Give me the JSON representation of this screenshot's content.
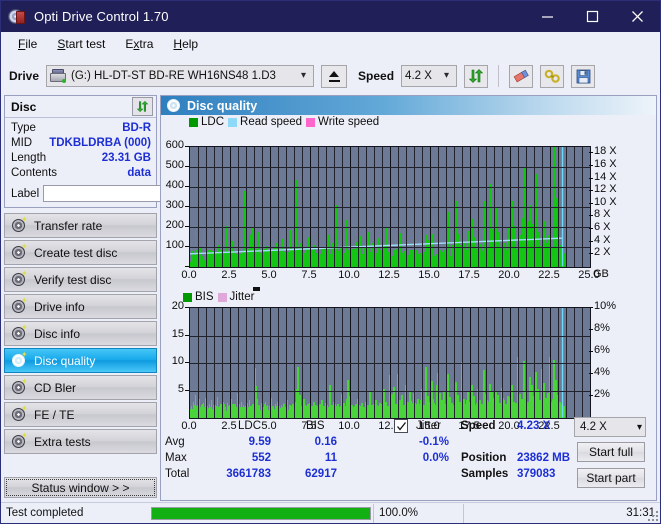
{
  "window": {
    "title": "Opti Drive Control 1.70",
    "app_icon": "disc-icon",
    "minimize": "minimize-icon",
    "maximize": "maximize-icon",
    "close": "close-icon"
  },
  "menu": {
    "items": [
      {
        "label": "File",
        "accel": "F"
      },
      {
        "label": "Start test",
        "accel": "S"
      },
      {
        "label": "Extra",
        "accel": "x"
      },
      {
        "label": "Help",
        "accel": "H"
      }
    ]
  },
  "toolbar": {
    "drive_label": "Drive",
    "drive_value": "(G:)  HL-DT-ST BD-RE  WH16NS48 1.D3",
    "eject_title": "eject-button",
    "speed_label": "Speed",
    "speed_value": "4.2 X",
    "refresh_title": "refresh-button",
    "erase_title": "erase-button",
    "tools_title": "tools-button",
    "save_title": "save-button"
  },
  "disc_panel": {
    "title": "Disc",
    "refresh_title": "refresh-disc-button",
    "rows": [
      {
        "key": "Type",
        "value": "BD-R"
      },
      {
        "key": "MID",
        "value": "TDKBLDRBA (000)"
      },
      {
        "key": "Length",
        "value": "23.31 GB"
      },
      {
        "key": "Contents",
        "value": "data"
      }
    ],
    "label_key": "Label",
    "label_value": "",
    "label_placeholder": ""
  },
  "sidebar": {
    "items": [
      {
        "label": "Transfer rate",
        "active": false
      },
      {
        "label": "Create test disc",
        "active": false
      },
      {
        "label": "Verify test disc",
        "active": false
      },
      {
        "label": "Drive info",
        "active": false
      },
      {
        "label": "Disc info",
        "active": false
      },
      {
        "label": "Disc quality",
        "active": true
      },
      {
        "label": "CD Bler",
        "active": false
      },
      {
        "label": "FE / TE",
        "active": false
      },
      {
        "label": "Extra tests",
        "active": false
      }
    ],
    "status_window_button": "Status window > >"
  },
  "content": {
    "header_title": "Disc quality",
    "header_icon": "disc-quality-icon"
  },
  "chart_data": [
    {
      "type": "bar",
      "id": "ldc-chart",
      "title": "",
      "xlabel": "GB",
      "ylabel": "LDC",
      "ylim": [
        0,
        600
      ],
      "xlim": [
        0,
        25
      ],
      "grid": true,
      "legend_position": "top-left",
      "legend": [
        {
          "name": "LDC",
          "color": "#009900"
        },
        {
          "name": "Read speed",
          "color": "#8ed8f8"
        },
        {
          "name": "Write speed",
          "color": "#ff66cc"
        }
      ],
      "yticks": [
        0,
        100,
        200,
        300,
        400,
        500,
        600
      ],
      "ytick_labels": [
        "",
        "100",
        "200",
        "300",
        "400",
        "500",
        "600"
      ],
      "xticks": [
        0.0,
        2.5,
        5.0,
        7.5,
        10.0,
        12.5,
        15.0,
        17.5,
        20.0,
        22.5,
        25.0
      ],
      "xtick_labels": [
        "0.0",
        "2.5",
        "5.0",
        "7.5",
        "10.0",
        "12.5",
        "15.0",
        "17.5",
        "20.0",
        "22.5",
        "25.0"
      ],
      "x_unit": "GB",
      "y2_ticks": [
        2,
        4,
        6,
        8,
        10,
        12,
        14,
        16,
        18
      ],
      "y2_tick_labels": [
        "2 X",
        "4 X",
        "6 X",
        "8 X",
        "10 X",
        "12 X",
        "14 X",
        "16 X",
        "18 X"
      ],
      "y2_label": "X",
      "series": [
        {
          "name": "LDC",
          "color": "#14c614",
          "data_x_end": 23.4,
          "baseline": 55,
          "values": [
            120,
            70,
            180,
            60,
            150,
            95,
            200,
            75,
            110,
            185,
            65,
            130,
            90,
            175,
            60,
            100,
            155,
            70,
            420,
            85,
            120,
            190,
            65,
            270,
            95,
            145,
            60,
            380,
            110,
            75,
            160,
            200,
            65,
            90,
            175,
            70,
            130,
            60,
            105,
            85,
            150,
            70,
            95,
            120,
            60,
            80,
            140,
            65,
            100,
            75,
            185,
            60,
            90,
            435,
            70,
            120,
            215,
            65,
            95,
            150,
            60,
            85,
            110,
            70,
            130,
            60,
            100,
            90,
            75,
            160,
            65,
            120,
            85,
            310,
            70,
            95,
            140,
            60,
            235,
            80,
            110,
            65,
            90,
            125,
            70,
            155,
            60,
            100,
            85,
            175,
            65,
            120,
            90,
            70,
            145,
            60,
            380,
            105,
            75,
            270,
            130,
            200,
            85,
            160,
            70,
            240,
            95,
            180,
            65,
            150,
            110,
            90,
            175,
            245,
            80,
            130,
            100,
            190,
            70,
            410,
            150,
            95,
            260,
            120,
            85,
            330,
            175,
            105,
            200,
            90,
            420,
            140,
            110,
            75,
            330,
            165,
            95,
            460,
            125,
            85,
            180,
            110,
            240,
            150,
            90,
            200,
            115,
            80,
            330,
            160,
            100,
            415,
            190,
            130,
            300,
            175,
            95,
            290,
            120,
            85,
            200,
            145,
            330,
            110,
            90,
            430,
            160,
            120,
            495,
            180,
            95,
            310,
            215,
            140,
            465,
            175,
            105,
            390,
            230,
            120,
            160,
            340,
            100,
            600,
            345,
            150,
            110,
            85,
            70
          ]
        },
        {
          "name": "Read speed",
          "color": "#8ed8f8",
          "start_value": 2.0,
          "end_value": 4.5,
          "description": "monotonically increasing stepped CAV read speed curve"
        },
        {
          "name": "Write speed",
          "color": "#ff66cc",
          "values": []
        }
      ]
    },
    {
      "type": "bar",
      "id": "bis-chart",
      "title": "",
      "xlabel": "GB",
      "ylabel": "BIS",
      "ylim": [
        0,
        20
      ],
      "xlim": [
        0,
        25
      ],
      "grid": true,
      "legend_position": "top-left",
      "legend": [
        {
          "name": "BIS",
          "color": "#009900"
        },
        {
          "name": "Jitter",
          "color": "#e0a8d8"
        }
      ],
      "yticks": [
        5,
        10,
        15,
        20
      ],
      "ytick_labels": [
        "5",
        "10",
        "15",
        "20"
      ],
      "xticks": [
        0.0,
        2.5,
        5.0,
        7.5,
        10.0,
        12.5,
        15.0,
        17.5,
        20.0,
        22.5,
        25.0
      ],
      "xtick_labels": [
        "0.0",
        "2.5",
        "5.0",
        "7.5",
        "10.0",
        "12.5",
        "15.0",
        "17.5",
        "20.0",
        "22.5",
        "25.0"
      ],
      "x_unit": "GB",
      "y2_ticks": [
        2,
        4,
        6,
        8,
        10
      ],
      "y2_tick_labels": [
        "2%",
        "4%",
        "6%",
        "8%",
        "10%"
      ],
      "series": [
        {
          "name": "BIS",
          "color": "#4ad43c",
          "data_x_end": 23.4,
          "baseline": 1.6,
          "values": [
            2.2,
            3.0,
            4.2,
            2.4,
            3.4,
            2.0,
            2.8,
            3.6,
            2.2,
            2.6,
            3.2,
            2.0,
            2.4,
            3.8,
            2.2,
            2.6,
            3.0,
            2.0,
            2.8,
            2.4,
            3.4,
            2.0,
            2.6,
            4.6,
            2.2,
            3.0,
            2.4,
            2.0,
            2.8,
            3.2,
            2.2,
            2.6,
            9.1,
            3.4,
            2.2,
            2.8,
            2.0,
            3.0,
            2.4,
            2.2,
            3.6,
            2.0,
            2.6,
            3.0,
            2.2,
            2.4,
            2.8,
            2.0,
            3.2,
            2.4,
            2.0,
            2.6,
            3.0,
            9.2,
            4.2,
            2.2,
            3.4,
            2.0,
            2.6,
            2.8,
            2.2,
            3.0,
            2.4,
            2.0,
            2.6,
            3.2,
            2.2,
            2.8,
            2.0,
            6.0,
            2.4,
            3.0,
            2.2,
            2.6,
            2.0,
            4.4,
            2.8,
            2.2,
            7.0,
            3.0,
            2.4,
            2.0,
            2.6,
            3.4,
            2.2,
            2.8,
            2.0,
            3.0,
            2.4,
            5.0,
            2.2,
            2.6,
            3.2,
            2.0,
            2.8,
            2.4,
            5.2,
            3.0,
            2.2,
            7.8,
            4.4,
            5.6,
            2.6,
            8.0,
            3.2,
            4.2,
            2.4,
            6.0,
            3.0,
            5.0,
            2.8,
            4.6,
            2.2,
            3.4,
            2.6,
            5.2,
            2.4,
            9.2,
            4.0,
            3.0,
            6.8,
            2.8,
            2.4,
            8.2,
            4.6,
            3.2,
            5.0,
            2.6,
            8.0,
            3.8,
            2.8,
            2.4,
            6.6,
            4.2,
            3.0,
            10.1,
            3.4,
            2.6,
            5.0,
            3.0,
            6.0,
            4.0,
            2.4,
            5.2,
            3.2,
            2.6,
            8.8,
            4.4,
            3.0,
            6.2,
            5.0,
            3.6,
            4.8,
            4.2,
            2.8,
            5.4,
            3.2,
            2.6,
            4.0,
            3.8,
            6.0,
            3.0,
            2.8,
            11.1,
            4.4,
            3.4,
            10.3,
            5.0,
            3.0,
            7.4,
            6.0,
            4.0,
            8.3,
            5.2,
            3.2,
            9.0,
            6.4,
            3.6,
            4.6,
            11.1,
            3.0,
            10.6,
            7.0,
            4.2,
            3.0,
            2.6,
            2.2
          ]
        },
        {
          "name": "Jitter",
          "color": "#e0a8d8",
          "values": []
        }
      ]
    }
  ],
  "stats": {
    "col_headers": [
      "LDC",
      "BIS"
    ],
    "row_labels": [
      "Avg",
      "Max",
      "Total"
    ],
    "ldc": {
      "avg": "9.59",
      "max": "552",
      "total": "3661783"
    },
    "bis": {
      "avg": "0.16",
      "max": "11",
      "total": "62917"
    },
    "jitter": {
      "label": "Jitter",
      "checked": true,
      "avg": "-0.1%",
      "max": "0.0%"
    },
    "speed_label": "Speed",
    "speed_value": "4.23 X",
    "position_label": "Position",
    "position_value": "23862 MB",
    "samples_label": "Samples",
    "samples_value": "379083",
    "speed_select": "4.2 X",
    "start_full_button": "Start full",
    "start_part_button": "Start part"
  },
  "statusbar": {
    "message": "Test completed",
    "progress_percent": "100.0%",
    "progress_value": 100,
    "elapsed": "31:31"
  },
  "colors": {
    "titlebar": "#201f58",
    "accent": "#1d2fd4",
    "plot_bg": "#6d7a95",
    "ldc_green": "#14c614",
    "bis_green": "#4ad43c",
    "read_speed": "#8ed8f8",
    "write_speed": "#ff66cc",
    "jitter": "#e0a8d8",
    "active_nav": "#16a8ea",
    "progress": "#12b012"
  }
}
